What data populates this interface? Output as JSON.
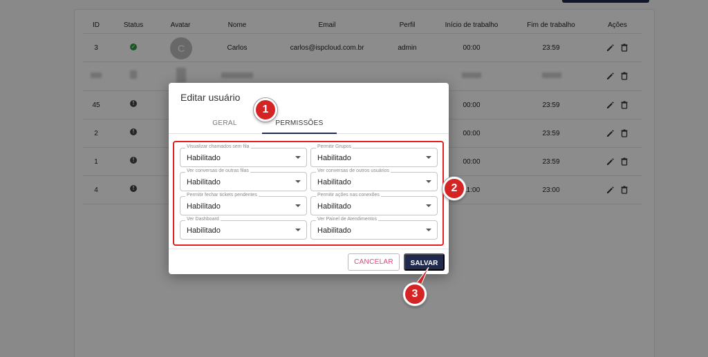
{
  "table": {
    "headers": [
      "ID",
      "Status",
      "Avatar",
      "Nome",
      "Email",
      "Perfil",
      "Início de trabalho",
      "Fim de trabalho",
      "Ações"
    ],
    "rows": [
      {
        "id": "3",
        "status": "online",
        "avatar": "C",
        "nome": "Carlos",
        "email": "carlos@ispcloud.com.br",
        "perfil": "admin",
        "inicio": "00:00",
        "fim": "23:59"
      },
      {
        "id": "",
        "status": "blurred",
        "avatar": "",
        "nome": "",
        "email": "",
        "perfil": "",
        "inicio": "",
        "fim": ""
      },
      {
        "id": "45",
        "status": "offline",
        "inicio": "00:00",
        "fim": "23:59"
      },
      {
        "id": "2",
        "status": "offline",
        "inicio": "00:00",
        "fim": "23:59"
      },
      {
        "id": "1",
        "status": "offline",
        "inicio": "00:00",
        "fim": "23:59"
      },
      {
        "id": "4",
        "status": "offline",
        "inicio": "11:00",
        "fim": "23:00"
      }
    ]
  },
  "modal": {
    "title": "Editar usuário",
    "tabs": [
      {
        "label": "GERAL",
        "active": false
      },
      {
        "label": "PERMISSÕES",
        "active": true
      }
    ],
    "fields": [
      {
        "label": "Visualizar chamados sem fila",
        "value": "Habilitado"
      },
      {
        "label": "Permitir Grupos",
        "value": "Habilitado"
      },
      {
        "label": "Ver conversas de outras filas",
        "value": "Habilitado"
      },
      {
        "label": "Ver conversas de outros usuários",
        "value": "Habilitado"
      },
      {
        "label": "Permitir fechar tickets pendentes",
        "value": "Habilitado"
      },
      {
        "label": "Permitir ações nas conexões",
        "value": "Habilitado"
      },
      {
        "label": "Ver Dashboard",
        "value": "Habilitado"
      },
      {
        "label": "Ver Painel de Atendimentos",
        "value": "Habilitado"
      }
    ],
    "cancel_label": "CANCELAR",
    "save_label": "SALVAR"
  },
  "callouts": [
    "1",
    "2",
    "3"
  ],
  "icons": {
    "status_ok": "check-circle-icon",
    "status_warn": "alert-circle-icon",
    "edit": "pencil-icon",
    "delete": "trash-icon",
    "select": "caret-down-icon"
  },
  "colors": {
    "primary": "#1f2a4d",
    "success": "#2e9d47",
    "callout": "#d42424",
    "cancel": "#e0447a",
    "highlight": "#e02020"
  }
}
